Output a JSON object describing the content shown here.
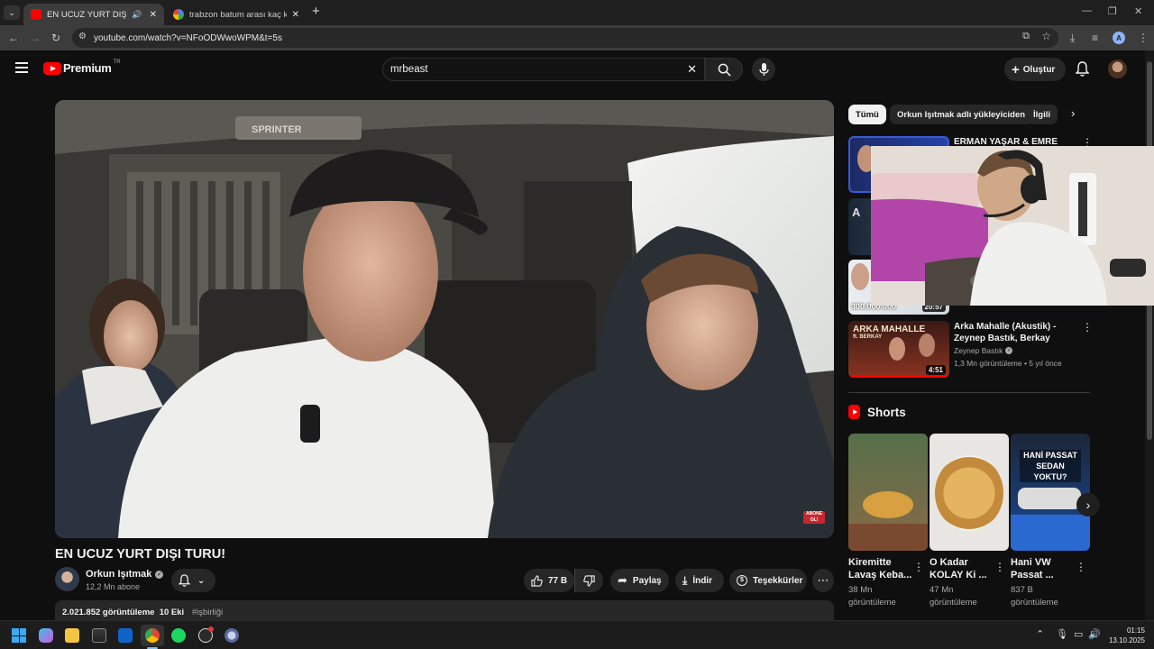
{
  "browser": {
    "tabs": [
      {
        "title": "EN UCUZ YURT DIŞI TURU!",
        "active": true
      },
      {
        "title": "trabzon batum arası kaç km - G",
        "active": false
      }
    ],
    "new_tab": "+",
    "url": "youtube.com/watch?v=NFoODWwoWPM&t=5s",
    "profile_initial": "A"
  },
  "youtube": {
    "logo": "Premium",
    "region": "TR",
    "search_value": "mrbeast",
    "create_label": "Oluştur"
  },
  "video": {
    "title": "EN UCUZ YURT DIŞI TURU!",
    "watermark": "ABONE OL!",
    "channel_name": "Orkun Işıtmak",
    "subscribers": "12,2 Mn abone",
    "likes": "77 B",
    "share": "Paylaş",
    "download": "İndir",
    "thanks": "Teşekkürler",
    "description_stats": "2.021.852 görüntüleme  10 Eki",
    "hashtag": "#işbirliği"
  },
  "chips": [
    "Tümü",
    "Orkun Işıtmak adlı yükleyiciden",
    "İlgili"
  ],
  "recommendations": [
    {
      "title": "ERMAN YAŞAR & EMRE ÖZCAN",
      "duration": ""
    },
    {
      "title": "",
      "duration": ""
    },
    {
      "title": "",
      "thumb_text": "300.000.000",
      "duration": "20:57"
    },
    {
      "title": "Arka Mahalle (Akustik) - Zeynep Bastık, Berkay",
      "thumb_text": "ARKA MAHALLE",
      "thumb_sub": "ft. BERKAY",
      "channel": "Zeynep Bastık",
      "meta": "1,3 Mn görüntüleme • 5 yıl önce",
      "duration": "4:51"
    }
  ],
  "shorts_header": "Shorts",
  "shorts": [
    {
      "title": "Kiremitte Lavaş Keba...",
      "views": "38 Mn görüntüleme"
    },
    {
      "title": "O Kadar KOLAY Ki ...",
      "views": "47 Mn görüntüleme"
    },
    {
      "title": "Hani VW Passat ...",
      "views": "837 B görüntüleme",
      "thumb_text": "HANİ PASSAT SEDAN YOKTU?"
    }
  ],
  "taskbar": {
    "time": "01:15",
    "date": "13.10.2025"
  },
  "colors": {
    "youtube_red": "#ff0000",
    "background": "#0f0f0f",
    "surface": "#272727",
    "muted_text": "#aaaaaa"
  }
}
